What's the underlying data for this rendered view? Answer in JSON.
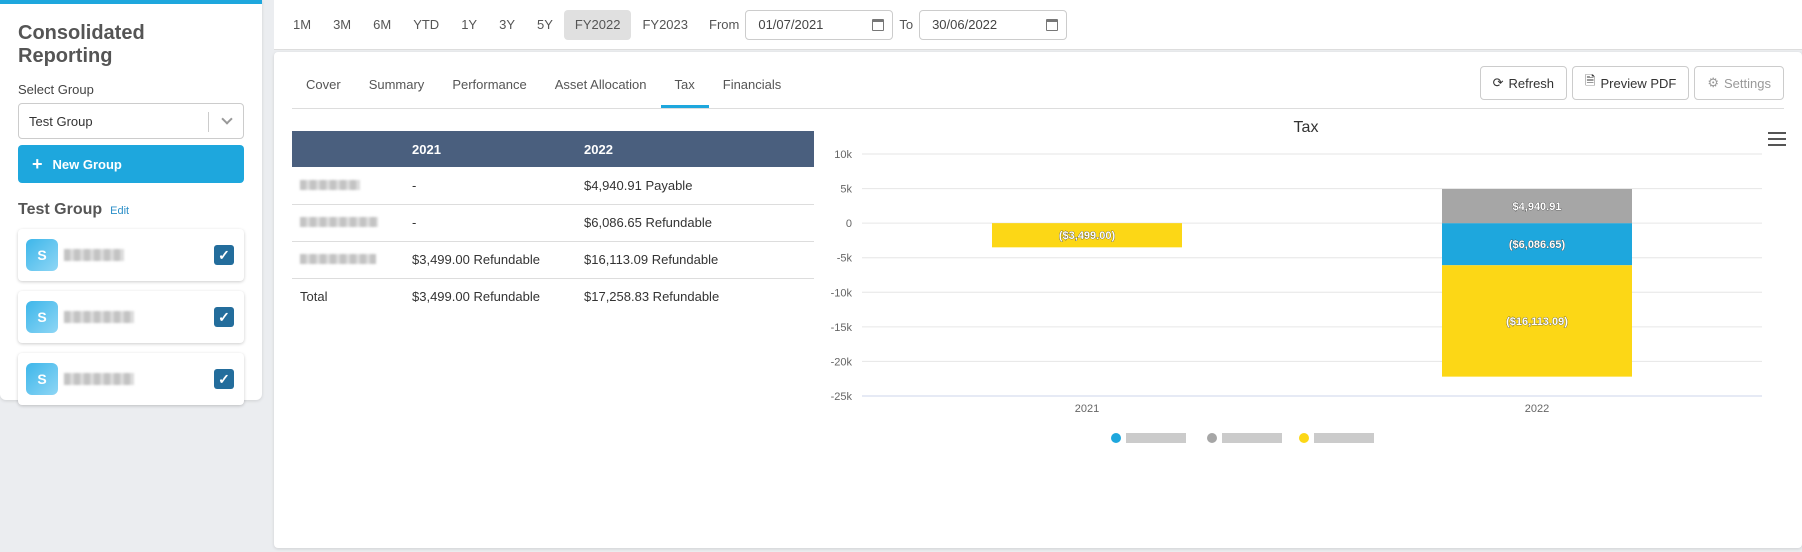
{
  "sidebar": {
    "title": "Consolidated Reporting",
    "select_label": "Select Group",
    "select_value": "Test Group",
    "new_group_label": "New Group",
    "group_name": "Test Group",
    "edit_label": "Edit",
    "entities": [
      {
        "checked": true
      },
      {
        "checked": true
      },
      {
        "checked": true
      }
    ]
  },
  "topbar": {
    "periods": [
      "1M",
      "3M",
      "6M",
      "YTD",
      "1Y",
      "3Y",
      "5Y",
      "FY2022",
      "FY2023"
    ],
    "active_period": "FY2022",
    "from_label": "From",
    "from_date": "01/07/2021",
    "to_label": "To",
    "to_date": "30/06/2022"
  },
  "tabs": [
    "Cover",
    "Summary",
    "Performance",
    "Asset Allocation",
    "Tax",
    "Financials"
  ],
  "active_tab": "Tax",
  "actions": {
    "refresh": "Refresh",
    "preview_pdf": "Preview PDF",
    "settings": "Settings"
  },
  "table": {
    "headers": [
      "",
      "2021",
      "2022"
    ],
    "rows": [
      {
        "c2021": "-",
        "c2022": "$4,940.91 Payable"
      },
      {
        "c2021": "-",
        "c2022": "$6,086.65 Refundable"
      },
      {
        "c2021": "$3,499.00 Refundable",
        "c2022": "$16,113.09 Refundable"
      }
    ],
    "total": {
      "label": "Total",
      "c2021": "$3,499.00 Refundable",
      "c2022": "$17,258.83 Refundable"
    }
  },
  "colors": {
    "blue": "#1ea7dd",
    "gray": "#a6a6a6",
    "yellow": "#fcd716",
    "header": "#4a5f7e"
  },
  "chart_data": {
    "type": "bar",
    "stacked": true,
    "title": "Tax",
    "categories": [
      "2021",
      "2022"
    ],
    "ylim": [
      -25000,
      10000
    ],
    "yticks": [
      "10k",
      "5k",
      "0",
      "-5k",
      "-10k",
      "-15k",
      "-20k",
      "-25k"
    ],
    "series": [
      {
        "color": "#1ea7dd",
        "values": [
          0,
          -6086.65
        ],
        "labels": [
          "",
          "($6,086.65)"
        ]
      },
      {
        "color": "#a6a6a6",
        "values": [
          0,
          4940.91
        ],
        "labels": [
          "",
          "$4,940.91"
        ]
      },
      {
        "color": "#fcd716",
        "values": [
          -3499.0,
          -16113.09
        ],
        "labels": [
          "($3,499.00)",
          "($16,113.09)"
        ]
      }
    ],
    "grid": true,
    "legend_position": "bottom"
  }
}
